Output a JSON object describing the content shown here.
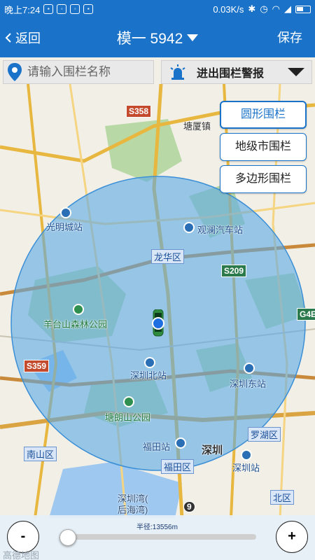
{
  "status_bar": {
    "time": "晚上7:24",
    "network_speed": "0.03K/s"
  },
  "header": {
    "back_label": "返回",
    "title": "模一 5942",
    "save_label": "保存"
  },
  "search": {
    "placeholder": "请输入围栏名称",
    "value": ""
  },
  "alarm_filter": {
    "selected": "进出围栏警报"
  },
  "fence_types": {
    "circle": "圆形围栏",
    "city": "地级市围栏",
    "polygon": "多边形围栏"
  },
  "map": {
    "places": {
      "tangxiazhen": "塘厦镇",
      "shenzhen": "深圳"
    },
    "roads": {
      "s358": "S358",
      "s209": "S209",
      "s359": "S359",
      "g4e": "G4E",
      "r9": "9"
    },
    "districts": {
      "longhua": "龙华区",
      "nanshan": "南山区",
      "futian": "福田区",
      "luohu": "罗湖区",
      "north": "北区"
    },
    "pois": {
      "guangmingcheng": "光明城站",
      "guanlan_bus": "观澜汽车站",
      "yangtaishan": "羊台山森林公园",
      "shenzhen_north": "深圳北站",
      "shenzhen_east": "深圳东站",
      "tanglangshan": "塘朗山公园",
      "futian_station": "福田站",
      "shenzhen_station": "深圳站",
      "shenzhen_bay": "深圳湾(",
      "houhai_bay": "后海湾)"
    },
    "fence_color": "#5aa8e6",
    "vehicle_color": "#2e8b3e"
  },
  "bottom": {
    "zoom_out": "-",
    "zoom_in": "+",
    "radius_label": "半径:13556m",
    "slider_position": 0.0,
    "watermark": "高德地图"
  },
  "colors": {
    "primary": "#1a73c9"
  }
}
